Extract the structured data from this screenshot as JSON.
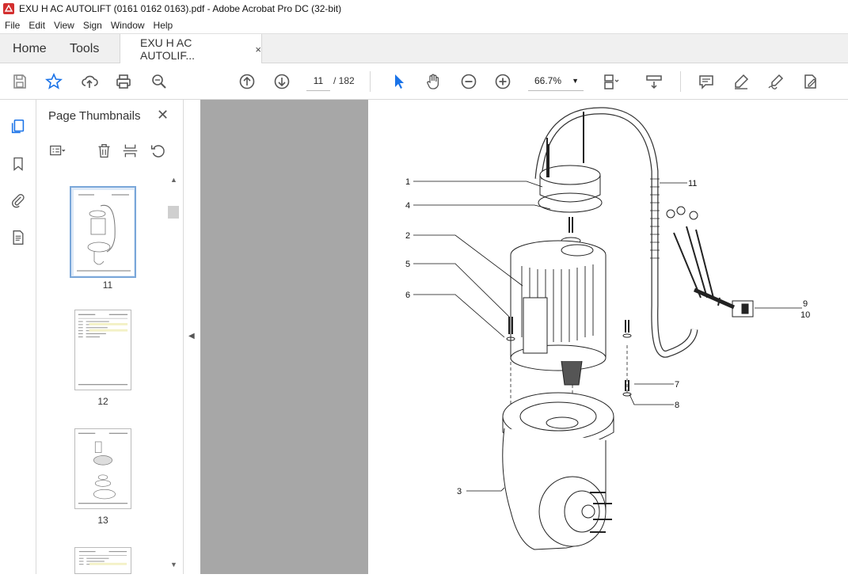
{
  "window": {
    "title": "EXU H AC AUTOLIFT (0161 0162 0163).pdf - Adobe Acrobat Pro DC (32-bit)"
  },
  "menu": [
    "File",
    "Edit",
    "View",
    "Sign",
    "Window",
    "Help"
  ],
  "tabs": {
    "home": "Home",
    "tools": "Tools",
    "document": "EXU H AC AUTOLIF...",
    "close": "×"
  },
  "toolbar": {
    "page_current": "11",
    "page_total": "/  182",
    "zoom": "66.7%",
    "icons": [
      "save-icon",
      "bookmark-star-icon",
      "upload-icon",
      "print-icon",
      "zoom-search-icon",
      "page-up-icon",
      "page-down-icon",
      "select-arrow-icon",
      "hand-icon",
      "zoom-out-icon",
      "zoom-in-icon",
      "zoom-dropdown-icon",
      "fit-page-icon",
      "scroll-mode-icon",
      "comment-icon",
      "highlight-icon",
      "sign-icon",
      "edit-pdf-icon"
    ]
  },
  "panel": {
    "title": "Page Thumbnails",
    "close": "✕",
    "thumbnails": [
      {
        "label": "11",
        "selected": true
      },
      {
        "label": "12",
        "selected": false
      },
      {
        "label": "13",
        "selected": false
      },
      {
        "label": "",
        "selected": false
      }
    ]
  },
  "drawing": {
    "callouts": [
      "1",
      "4",
      "2",
      "5",
      "6",
      "11",
      "9",
      "10",
      "7",
      "8",
      "3"
    ]
  },
  "colors": {
    "accent": "#1a73e8",
    "toolbar_bg": "#ffffff",
    "tab_bg": "#f0f0f0",
    "gutter": "#a7a7a7",
    "selection": "#dde9f7"
  }
}
